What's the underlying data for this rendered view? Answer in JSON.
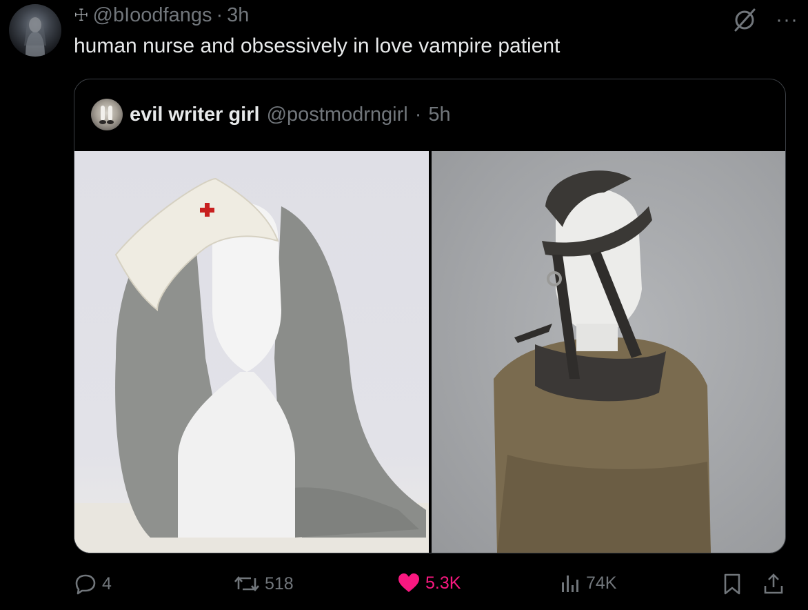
{
  "post": {
    "cross_glyph": "☩",
    "handle": "@bIoodfangs",
    "separator": "·",
    "time": "3h",
    "text": "human nurse and obsessively in love vampire patient",
    "more_glyph": "···"
  },
  "quote": {
    "name": "evil writer girl",
    "handle": "@postmodrngirl",
    "separator": "·",
    "time": "5h",
    "images": [
      {
        "icon": "nurse-cap-photo"
      },
      {
        "icon": "restraint-harness-photo"
      }
    ]
  },
  "actions": {
    "replies": "4",
    "reposts": "518",
    "likes": "5.3K",
    "views": "74K"
  },
  "colors": {
    "background": "#000000",
    "text": "#e7e9ea",
    "muted": "#71767b",
    "like": "#f91880",
    "border": "#3b3f44"
  }
}
